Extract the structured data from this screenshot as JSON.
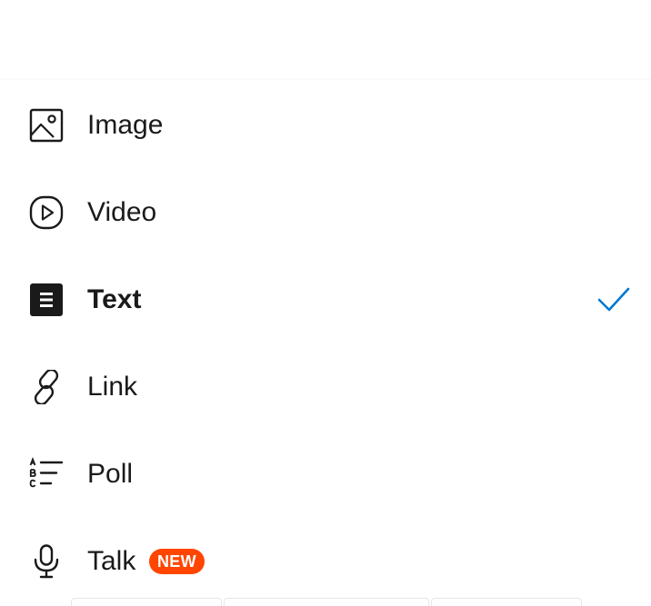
{
  "menu": {
    "items": [
      {
        "label": "Image",
        "icon": "image-icon",
        "selected": false
      },
      {
        "label": "Video",
        "icon": "video-icon",
        "selected": false
      },
      {
        "label": "Text",
        "icon": "text-icon",
        "selected": true
      },
      {
        "label": "Link",
        "icon": "link-icon",
        "selected": false
      },
      {
        "label": "Poll",
        "icon": "poll-icon",
        "selected": false
      },
      {
        "label": "Talk",
        "icon": "microphone-icon",
        "selected": false,
        "badge": "NEW"
      }
    ],
    "selected_icon": "checkmark-icon"
  },
  "colors": {
    "text": "#1a1a1b",
    "check": "#0079d3",
    "badge_bg": "#ff4500",
    "badge_text": "#ffffff"
  }
}
